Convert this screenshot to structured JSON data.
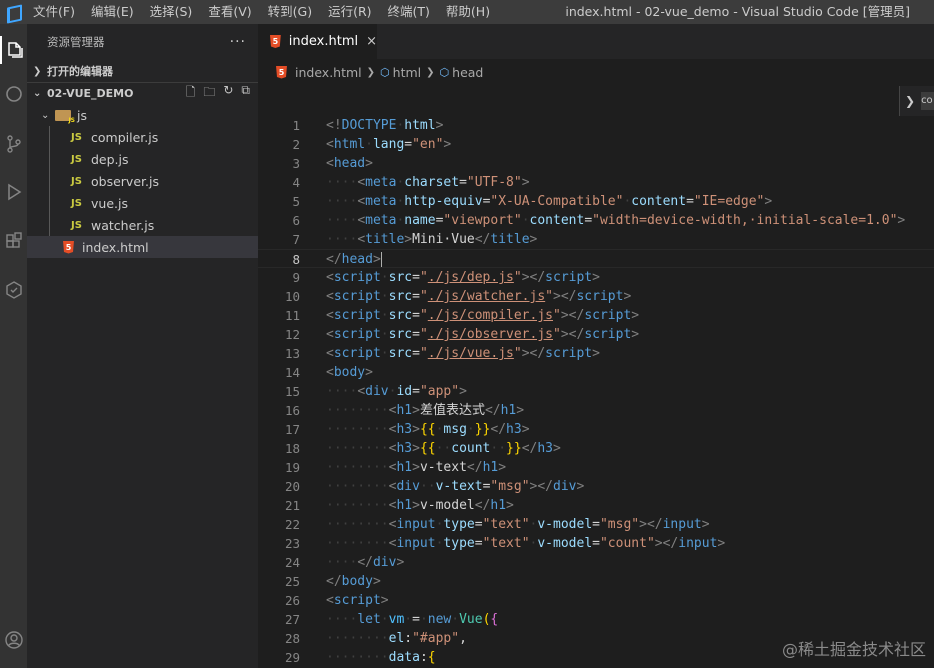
{
  "window": {
    "title": "index.html - 02-vue_demo - Visual Studio Code [管理员]",
    "menu": [
      "文件(F)",
      "编辑(E)",
      "选择(S)",
      "查看(V)",
      "转到(G)",
      "运行(R)",
      "终端(T)",
      "帮助(H)"
    ]
  },
  "sidebar": {
    "title": "资源管理器",
    "more": "···",
    "open_editors": "打开的编辑器",
    "project": "02-VUE_DEMO",
    "folder": "js",
    "files": [
      "compiler.js",
      "dep.js",
      "observer.js",
      "vue.js",
      "watcher.js"
    ],
    "selected_file": "index.html"
  },
  "tab": {
    "label": "index.html",
    "close": "×"
  },
  "breadcrumb": [
    "index.html",
    "html",
    "head"
  ],
  "peek": {
    "label": "co"
  },
  "editor": {
    "line_numbers": [
      "1",
      "2",
      "3",
      "4",
      "5",
      "6",
      "7",
      "8",
      "9",
      "10",
      "11",
      "12",
      "13",
      "14",
      "15",
      "16",
      "17",
      "18",
      "19",
      "20",
      "21",
      "22",
      "23",
      "24",
      "25",
      "26",
      "27",
      "28",
      "29"
    ],
    "current_line": 8
  },
  "watermark": "@稀土掘金技术社区",
  "colors": {
    "accent": "#007acc",
    "tag": "#569cd6",
    "attr": "#9cdcfe",
    "string": "#ce9178"
  }
}
